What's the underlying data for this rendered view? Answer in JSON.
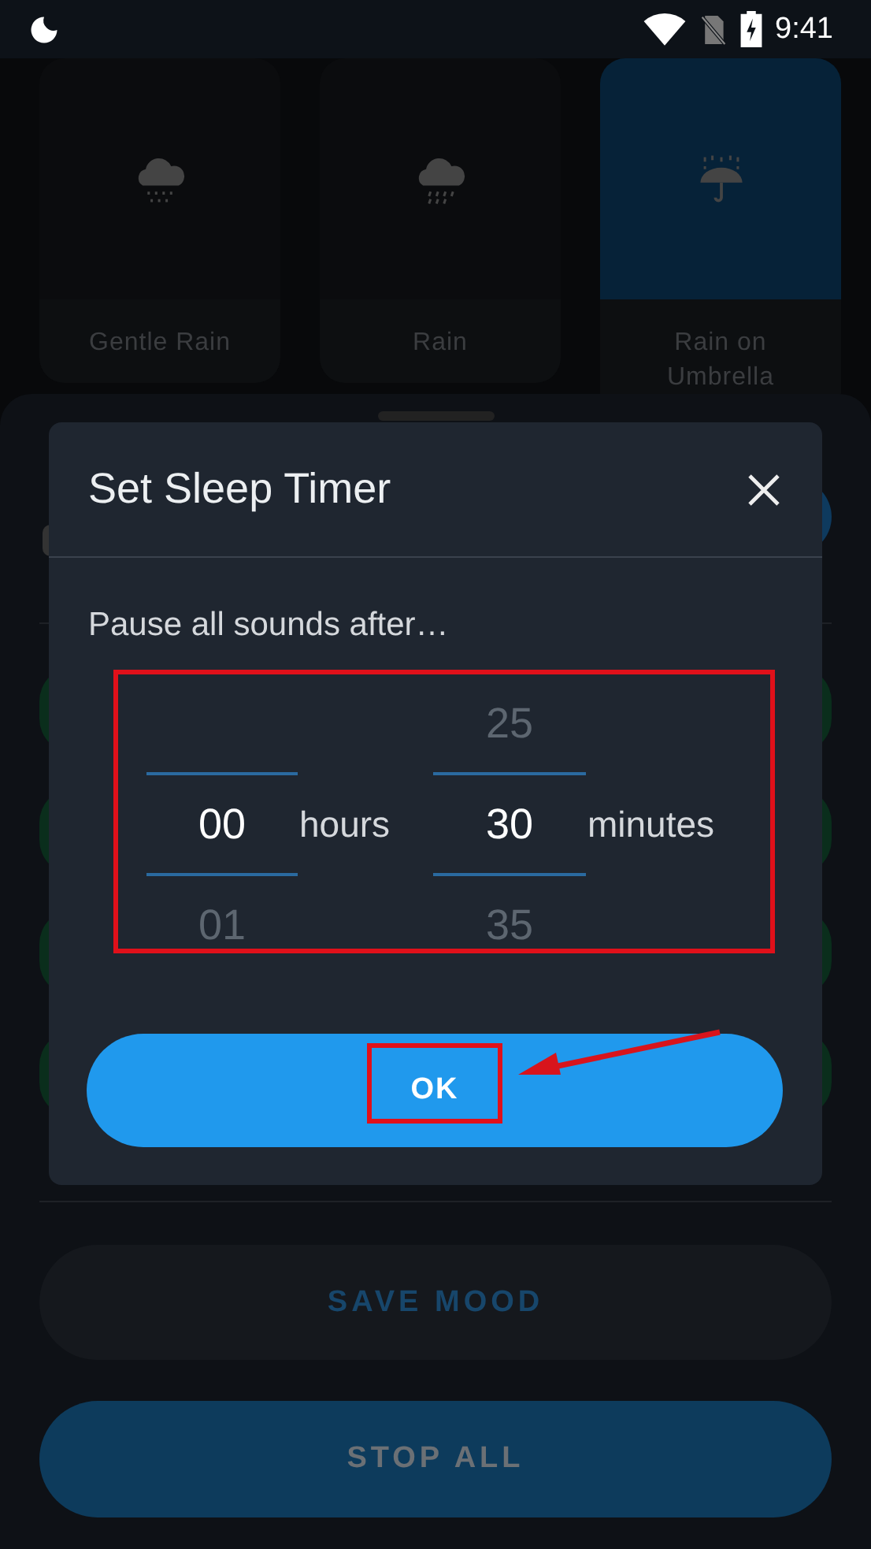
{
  "status_bar": {
    "time": "9:41"
  },
  "sound_cards": [
    {
      "label": "Gentle Rain",
      "kind": "drizzle",
      "selected": false
    },
    {
      "label": "Rain",
      "kind": "rain",
      "selected": false
    },
    {
      "label": "Rain on Umbrella",
      "kind": "umbrella",
      "selected": true
    }
  ],
  "dialog": {
    "title": "Set Sleep Timer",
    "prompt": "Pause all sounds after…",
    "pickers": [
      {
        "value": "00",
        "below": "01",
        "unit": "hours"
      },
      {
        "above": "25",
        "value": "30",
        "below": "35",
        "unit": "minutes"
      }
    ],
    "ok_button": "OK"
  },
  "buttons": [
    {
      "label": "SAVE MOOD",
      "kind": "secondary"
    },
    {
      "label": "STOP ALL",
      "kind": "primary"
    }
  ]
}
